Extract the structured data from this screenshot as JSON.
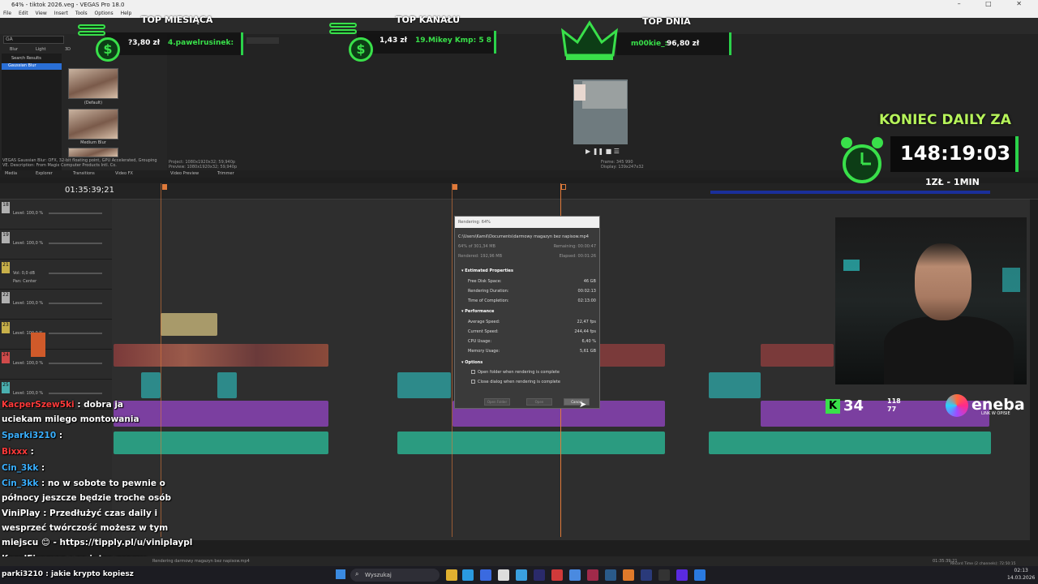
{
  "window": {
    "title": "64% - tiktok 2026.veg - VEGAS Pro 18.0",
    "controls": "– □ ✕"
  },
  "menu": [
    "File",
    "Edit",
    "View",
    "Insert",
    "Tools",
    "Options",
    "Help"
  ],
  "fx_panel": {
    "search_value": "GA",
    "tabs": [
      "Blur",
      "Light",
      "3D"
    ],
    "list": [
      "Search Results",
      "Gaussian Blur"
    ],
    "thumbnails": [
      "(Default)",
      "Medium Blur"
    ],
    "description": "VEGAS Gaussian Blur: OFX, 32-bit floating point, GPU Accelerated, Grouping VE. Description: From Magix Computer Products Intl. Co."
  },
  "pane_tabs": [
    "Media",
    "Explorer",
    "Transitions",
    "Video FX",
    "Video Preview",
    "Trimmer"
  ],
  "preview": {
    "project": "Project: 1080x1920x32; 59,940p",
    "preview": "Preview: 1080x1920x32; 59,940p",
    "frame": "Frame:",
    "frame_value": "345 990",
    "display": "Display:",
    "display_value": "139x247x32"
  },
  "timeline": {
    "timecode": "01:35:39;21",
    "tracks": [
      {
        "num": "18",
        "level": "Level: 100,0 %",
        "color": "#b0b0b0"
      },
      {
        "num": "19",
        "level": "Level: 100,0 %",
        "color": "#b0b0b0"
      },
      {
        "num": "21",
        "level": "Vol: 0,0 dB",
        "pan": "Pan: Center",
        "color": "#c8b04a"
      },
      {
        "num": "22",
        "level": "Level: 100,0 %",
        "color": "#b0b0b0"
      },
      {
        "num": "23",
        "level": "Level: 100,0 %",
        "color": "#c8b04a"
      },
      {
        "num": "24",
        "level": "Level: 100,0 %",
        "color": "#d04a4a"
      },
      {
        "num": "25",
        "level": "Level: 100,0 %",
        "color": "#4ab0b0"
      }
    ]
  },
  "render_dialog": {
    "title": "Rendering: 64%",
    "path": "C:\\Users\\Kamil\\Documents\\darmowy magazyn bez napisow.mp4",
    "progress": "64% of 301,34 MB",
    "remaining": "Remaining: 00:00:47",
    "rendered": "Rendered: 192,96 MB",
    "elapsed": "Elapsed: 00:01:26",
    "sec_estimated": "Estimated Properties",
    "free_disk_label": "Free Disk Space:",
    "free_disk": "46 GB",
    "render_dur_label": "Rendering Duration:",
    "render_dur": "00:02:13",
    "completion_label": "Time of Completion:",
    "completion": "02:13:00",
    "sec_perf": "Performance",
    "avg_speed_label": "Average Speed:",
    "avg_speed": "22,47 fps",
    "cur_speed_label": "Current Speed:",
    "cur_speed": "244,44 fps",
    "cpu_label": "CPU Usage:",
    "cpu": "6,40 %",
    "mem_label": "Memory Usage:",
    "mem": "5,61 GB",
    "sec_options": "Options",
    "opt1": "Open folder when rendering is complete",
    "opt2": "Close dialog when rendering is complete",
    "btn_open_folder": "Open Folder",
    "btn_open": "Open",
    "btn_cancel": "Cancel"
  },
  "overlay": {
    "top_month": {
      "title": "TOP MIESIĄCA",
      "amount": "?3,80 zł",
      "name": "4.pawelrusinek:"
    },
    "top_channel": {
      "title": "TOP KANAŁU",
      "amount": "1,43 zł",
      "name": "19.Mikey Kmp: 5 8"
    },
    "top_day": {
      "title": "TOP DNIA",
      "name": "m00kie_:",
      "amount": "96,80 zł"
    },
    "daily": {
      "title": "KONIEC DAILY ZA",
      "time": "148:19:03",
      "sub": "1ZŁ - 1MIN"
    },
    "kick": {
      "count": "34",
      "stat1": "118",
      "stat2": "77"
    },
    "eneba": {
      "brand": "eneba",
      "sub": "LINK W OPISIE"
    }
  },
  "chat": [
    {
      "user": "KacperSzew5ki",
      "msg": ": dobra ja",
      "red": true
    },
    {
      "user": "",
      "msg": "uciekam milego montowania",
      "red": false
    },
    {
      "user": "Sparki3210",
      "msg": ":",
      "red": false
    },
    {
      "user": "Bixxx",
      "msg": ":",
      "red": true
    },
    {
      "user": "Cin_3kk",
      "msg": ":",
      "red": false
    },
    {
      "user": "Cin_3kk",
      "msg": ": no w sobote to pewnie o",
      "red": false
    },
    {
      "user": "",
      "msg": "północy jeszcze będzie troche osób",
      "red": false
    },
    {
      "user": "ViniPlay",
      "msg": ": Przedłużyć czas daily i",
      "red": false
    },
    {
      "user": "",
      "msg": "wesprzeć twórczość możesz w tym",
      "red": false
    },
    {
      "user": "",
      "msg": "miejscu 😊 - https://tipply.pl/u/viniplaypl",
      "red": false
    },
    {
      "user": "KarolFireman",
      "msg": ": co jutro gramy",
      "red": false
    },
    {
      "user": "parki3210",
      "msg": ": jakie krypto kopiesz",
      "red": false
    }
  ],
  "status": {
    "render_text": "Rendering darmowy magazyn bez napisow.mp4",
    "end_time": "01:35:39;21",
    "record": "Record Time (2 channels): 72:50:15"
  },
  "taskbar": {
    "search": "Wyszukaj",
    "time": "02:13",
    "date": "14.03.2026"
  },
  "colors": {
    "accent_green": "#39e04a",
    "playhead": "#e07a3a"
  }
}
